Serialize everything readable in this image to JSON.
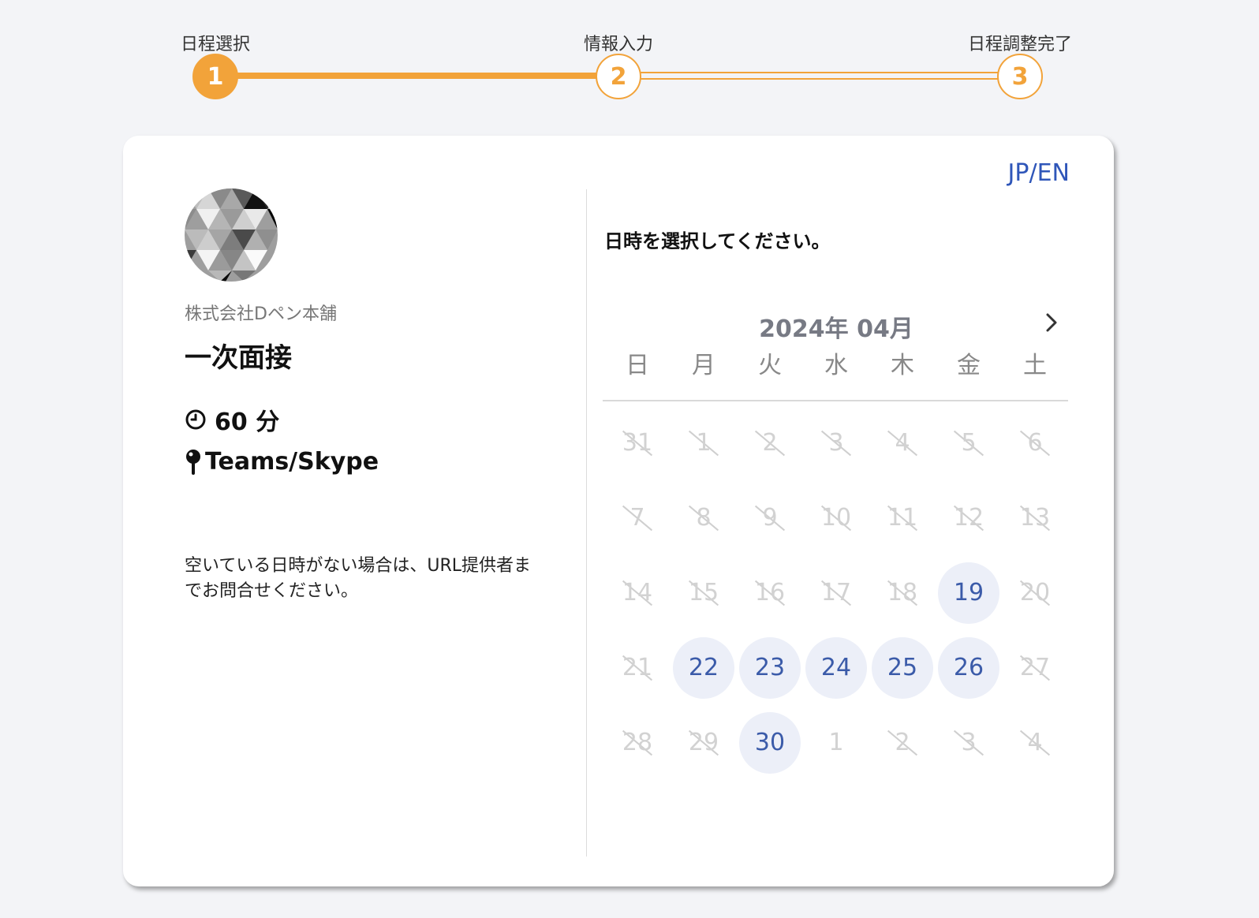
{
  "stepper": {
    "steps": [
      {
        "number": "1",
        "label": "日程選択"
      },
      {
        "number": "2",
        "label": "情報入力"
      },
      {
        "number": "3",
        "label": "日程調整完了"
      }
    ]
  },
  "header": {
    "language_switch": "JP/EN"
  },
  "profile": {
    "avatar_icon": "avatar-icon",
    "company": "株式会社Dペン本舗",
    "event_title": "一次面接",
    "duration": "60 分",
    "duration_icon": "clock-icon",
    "location": "Teams/Skype",
    "location_icon": "pin-icon",
    "note": "空いている日時がない場合は、URL提供者までお問合せください。"
  },
  "calendar": {
    "instruction": "日時を選択してください。",
    "month_label": "2024年 04月",
    "next_icon": "chevron-right-icon",
    "weekdays": [
      "日",
      "月",
      "火",
      "水",
      "木",
      "金",
      "土"
    ],
    "days": [
      {
        "label": "31",
        "state": "disabled"
      },
      {
        "label": "1",
        "state": "disabled"
      },
      {
        "label": "2",
        "state": "disabled"
      },
      {
        "label": "3",
        "state": "disabled"
      },
      {
        "label": "4",
        "state": "disabled"
      },
      {
        "label": "5",
        "state": "disabled"
      },
      {
        "label": "6",
        "state": "disabled"
      },
      {
        "label": "7",
        "state": "disabled"
      },
      {
        "label": "8",
        "state": "disabled"
      },
      {
        "label": "9",
        "state": "disabled"
      },
      {
        "label": "10",
        "state": "disabled"
      },
      {
        "label": "11",
        "state": "disabled"
      },
      {
        "label": "12",
        "state": "disabled"
      },
      {
        "label": "13",
        "state": "disabled"
      },
      {
        "label": "14",
        "state": "disabled"
      },
      {
        "label": "15",
        "state": "disabled"
      },
      {
        "label": "16",
        "state": "disabled"
      },
      {
        "label": "17",
        "state": "disabled"
      },
      {
        "label": "18",
        "state": "disabled"
      },
      {
        "label": "19",
        "state": "available"
      },
      {
        "label": "20",
        "state": "disabled"
      },
      {
        "label": "21",
        "state": "disabled"
      },
      {
        "label": "22",
        "state": "available"
      },
      {
        "label": "23",
        "state": "available"
      },
      {
        "label": "24",
        "state": "available"
      },
      {
        "label": "25",
        "state": "available"
      },
      {
        "label": "26",
        "state": "available"
      },
      {
        "label": "27",
        "state": "disabled"
      },
      {
        "label": "28",
        "state": "disabled"
      },
      {
        "label": "29",
        "state": "disabled"
      },
      {
        "label": "30",
        "state": "available"
      },
      {
        "label": "1",
        "state": "outside"
      },
      {
        "label": "2",
        "state": "disabled"
      },
      {
        "label": "3",
        "state": "disabled"
      },
      {
        "label": "4",
        "state": "disabled"
      }
    ]
  },
  "colors": {
    "accent": "#f2a33a",
    "link": "#2f56b9",
    "available_text": "#3b5ba9",
    "available_bg": "#eceff8",
    "disabled_text": "#d2d2d2"
  }
}
